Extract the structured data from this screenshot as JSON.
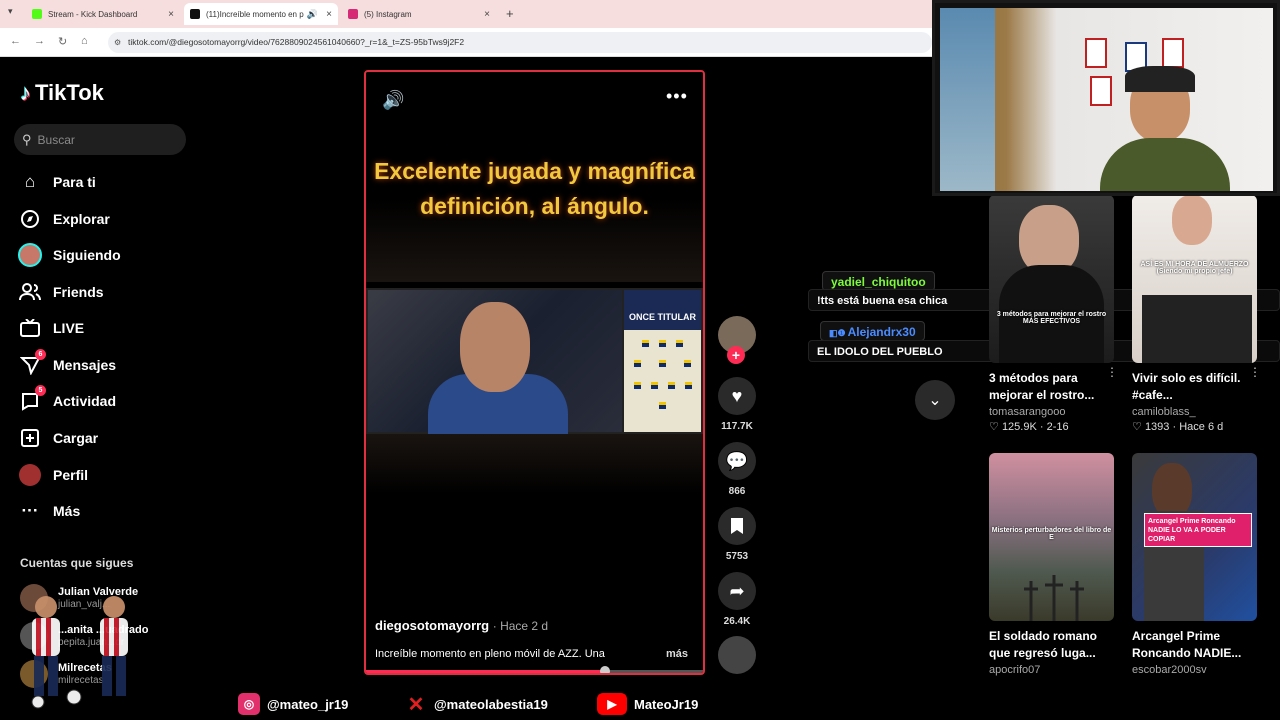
{
  "browser": {
    "tabs": [
      {
        "label": "Stream - Kick Dashboard",
        "color": "#53fc18"
      },
      {
        "label": "(11)Increíble momento en p",
        "color": "#111111"
      },
      {
        "label": "(5) Instagram",
        "color": "#d62976"
      }
    ],
    "new_tab": "+",
    "close": "×",
    "url": "tiktok.com/@diegosotomayorrg/video/7628809024561040660?_r=1&_t=ZS-95bTws9j2F2"
  },
  "sidebar": {
    "logo": "TikTok",
    "search_placeholder": "Buscar",
    "nav": [
      {
        "label": "Para ti",
        "icon": "home-icon",
        "badge": ""
      },
      {
        "label": "Explorar",
        "icon": "compass-icon",
        "badge": ""
      },
      {
        "label": "Siguiendo",
        "icon": "following-avatar-icon",
        "badge": ""
      },
      {
        "label": "Friends",
        "icon": "friends-icon",
        "badge": ""
      },
      {
        "label": "LIVE",
        "icon": "live-icon",
        "badge": ""
      },
      {
        "label": "Mensajes",
        "icon": "messages-icon",
        "badge": "6"
      },
      {
        "label": "Actividad",
        "icon": "activity-icon",
        "badge": "5"
      },
      {
        "label": "Cargar",
        "icon": "upload-icon",
        "badge": ""
      },
      {
        "label": "Perfil",
        "icon": "profile-avatar-icon",
        "badge": ""
      },
      {
        "label": "Más",
        "icon": "more-icon",
        "badge": ""
      }
    ],
    "following_title": "Cuentas que sigues",
    "following": [
      {
        "name": "Julian Valverde",
        "handle": "julian_valj..."
      },
      {
        "name": "...anita ...uadrado",
        "handle": "pepita.juan...dr"
      },
      {
        "name": "Milrecetas",
        "handle": "milrecetas"
      }
    ]
  },
  "video": {
    "caption": "Excelente jugada y magnífica definición, al ángulo.",
    "lineup_title": "ONCE TITULAR",
    "author": "diegosotomayorrg",
    "posted": "· Hace 2 d",
    "description": "Increíble momento en pleno móvil de AZZ. Una",
    "more": "más",
    "progress": 0.71
  },
  "actions": {
    "likes": "117.7K",
    "comments": "866",
    "saves": "5753",
    "shares": "26.4K"
  },
  "chat": [
    {
      "user": "yadiel_chiquitoo",
      "user_color": "#7cfc3a",
      "message": "!tts está buena esa chica"
    },
    {
      "user": "Alejandrx30",
      "user_color": "#4a8cff",
      "message": "EL IDOLO DEL PUEBLO"
    }
  ],
  "recommended": [
    {
      "overlay": "3 métodos para mejorar el rostro MÁS EFECTIVOS",
      "title": "3 métodos para mejorar el rostro...",
      "user": "tomasarangooo",
      "likes": "125.9K",
      "date": "2-16"
    },
    {
      "overlay": "ASÍ ES MI HORA DE ALMUERZO (Siendo mi propio jefe)",
      "title": "Vivir solo es difícil. #cafe...",
      "user": "camiloblass_",
      "likes": "1393",
      "date": "Hace 6 d"
    },
    {
      "overlay": "Misterios perturbadores del libro de E",
      "title": "El soldado romano que regresó luga...",
      "user": "apocrifo07",
      "likes": "",
      "date": ""
    },
    {
      "overlay": "Arcangel Prime Roncando NADIE LO VA A PODER COPIAR",
      "title": "Arcangel Prime Roncando NADIE...",
      "user": "escobar2000sv",
      "likes": "",
      "date": ""
    }
  ],
  "socials": [
    {
      "handle": "@mateo_jr19",
      "icon": "instagram-icon",
      "color": "#e1306c"
    },
    {
      "handle": "@mateolabestia19",
      "icon": "x-icon",
      "color": "#e02020"
    },
    {
      "handle": "MateoJr19",
      "icon": "youtube-icon",
      "color": "#ff0000"
    }
  ]
}
